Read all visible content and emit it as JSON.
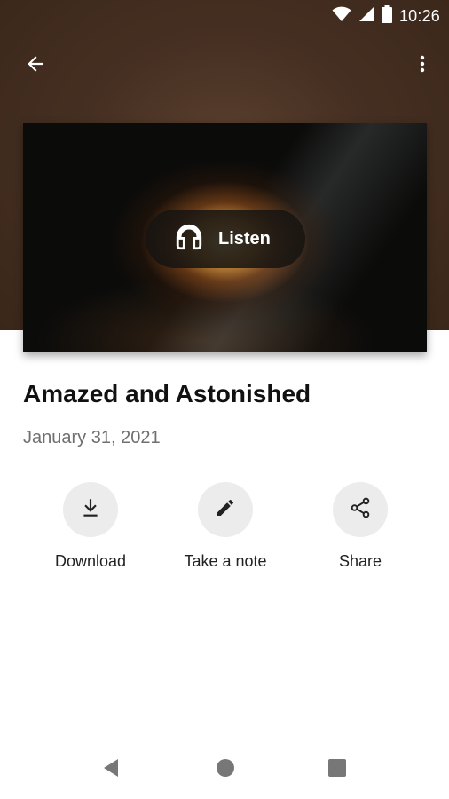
{
  "status_bar": {
    "time": "10:26",
    "icons": [
      "wifi-icon",
      "cell-signal-icon",
      "battery-icon"
    ]
  },
  "app_bar": {
    "back_icon": "arrow-back-icon",
    "menu_icon": "more-vert-icon"
  },
  "colors": {
    "hero_background": "#452f22",
    "action_circle": "#ececec",
    "date_text": "#6f6f6f"
  },
  "player": {
    "listen_label": "Listen",
    "icon": "headphones-icon"
  },
  "sermon": {
    "title": "Amazed and Astonished",
    "date": "January 31, 2021"
  },
  "actions": [
    {
      "label": "Download",
      "icon": "download-icon"
    },
    {
      "label": "Take a note",
      "icon": "pencil-icon"
    },
    {
      "label": "Share",
      "icon": "share-icon"
    }
  ],
  "nav_bar": {
    "icons": [
      "back-triangle-icon",
      "home-circle-icon",
      "recents-square-icon"
    ]
  }
}
